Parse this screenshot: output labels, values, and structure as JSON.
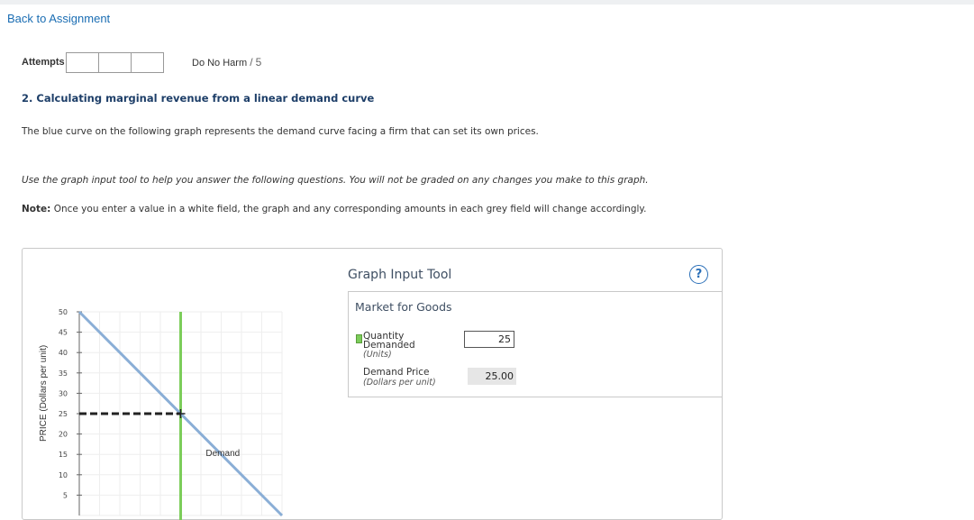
{
  "nav": {
    "back_label": "Back to Assignment"
  },
  "attempts": {
    "label": "Attempts",
    "boxes": 3
  },
  "do_no_harm": {
    "label": "Do No Harm",
    "separator": "/",
    "value": "5"
  },
  "question": {
    "title": "2. Calculating marginal revenue from a linear demand curve",
    "intro": "The blue curve on the following graph represents the demand curve facing a firm that can set its own prices.",
    "instruction": "Use the graph input tool to help you answer the following questions. You will not be graded on any changes you make to this graph.",
    "note_label": "Note:",
    "note_text": "Once you enter a value in a white field, the graph and any corresponding amounts in each grey field will change accordingly."
  },
  "tool": {
    "title": "Graph Input Tool",
    "help_symbol": "?",
    "market_title": "Market for Goods",
    "quantity_label_1": "Quantity",
    "quantity_label_2": "Demanded",
    "quantity_unit": "(Units)",
    "quantity_value": "25",
    "price_label": "Demand Price",
    "price_unit": "(Dollars per unit)",
    "price_value": "25.00"
  },
  "colors": {
    "demand_curve": "#8aaed6",
    "quantity_line": "#7ccd5a",
    "price_line": "#222222",
    "link": "#1a6db3",
    "title": "#1d3e68"
  },
  "chart_data": {
    "type": "line",
    "ylabel": "PRICE (Dollars per unit)",
    "xlabel": "",
    "ylim": [
      0,
      50
    ],
    "xlim": [
      0,
      50
    ],
    "yticks": [
      5,
      10,
      15,
      20,
      25,
      30,
      35,
      40,
      45,
      50
    ],
    "grid": true,
    "series": [
      {
        "name": "Demand",
        "x": [
          0,
          50
        ],
        "y": [
          50,
          0
        ]
      }
    ],
    "selected_point": {
      "x": 25,
      "y": 25
    }
  }
}
